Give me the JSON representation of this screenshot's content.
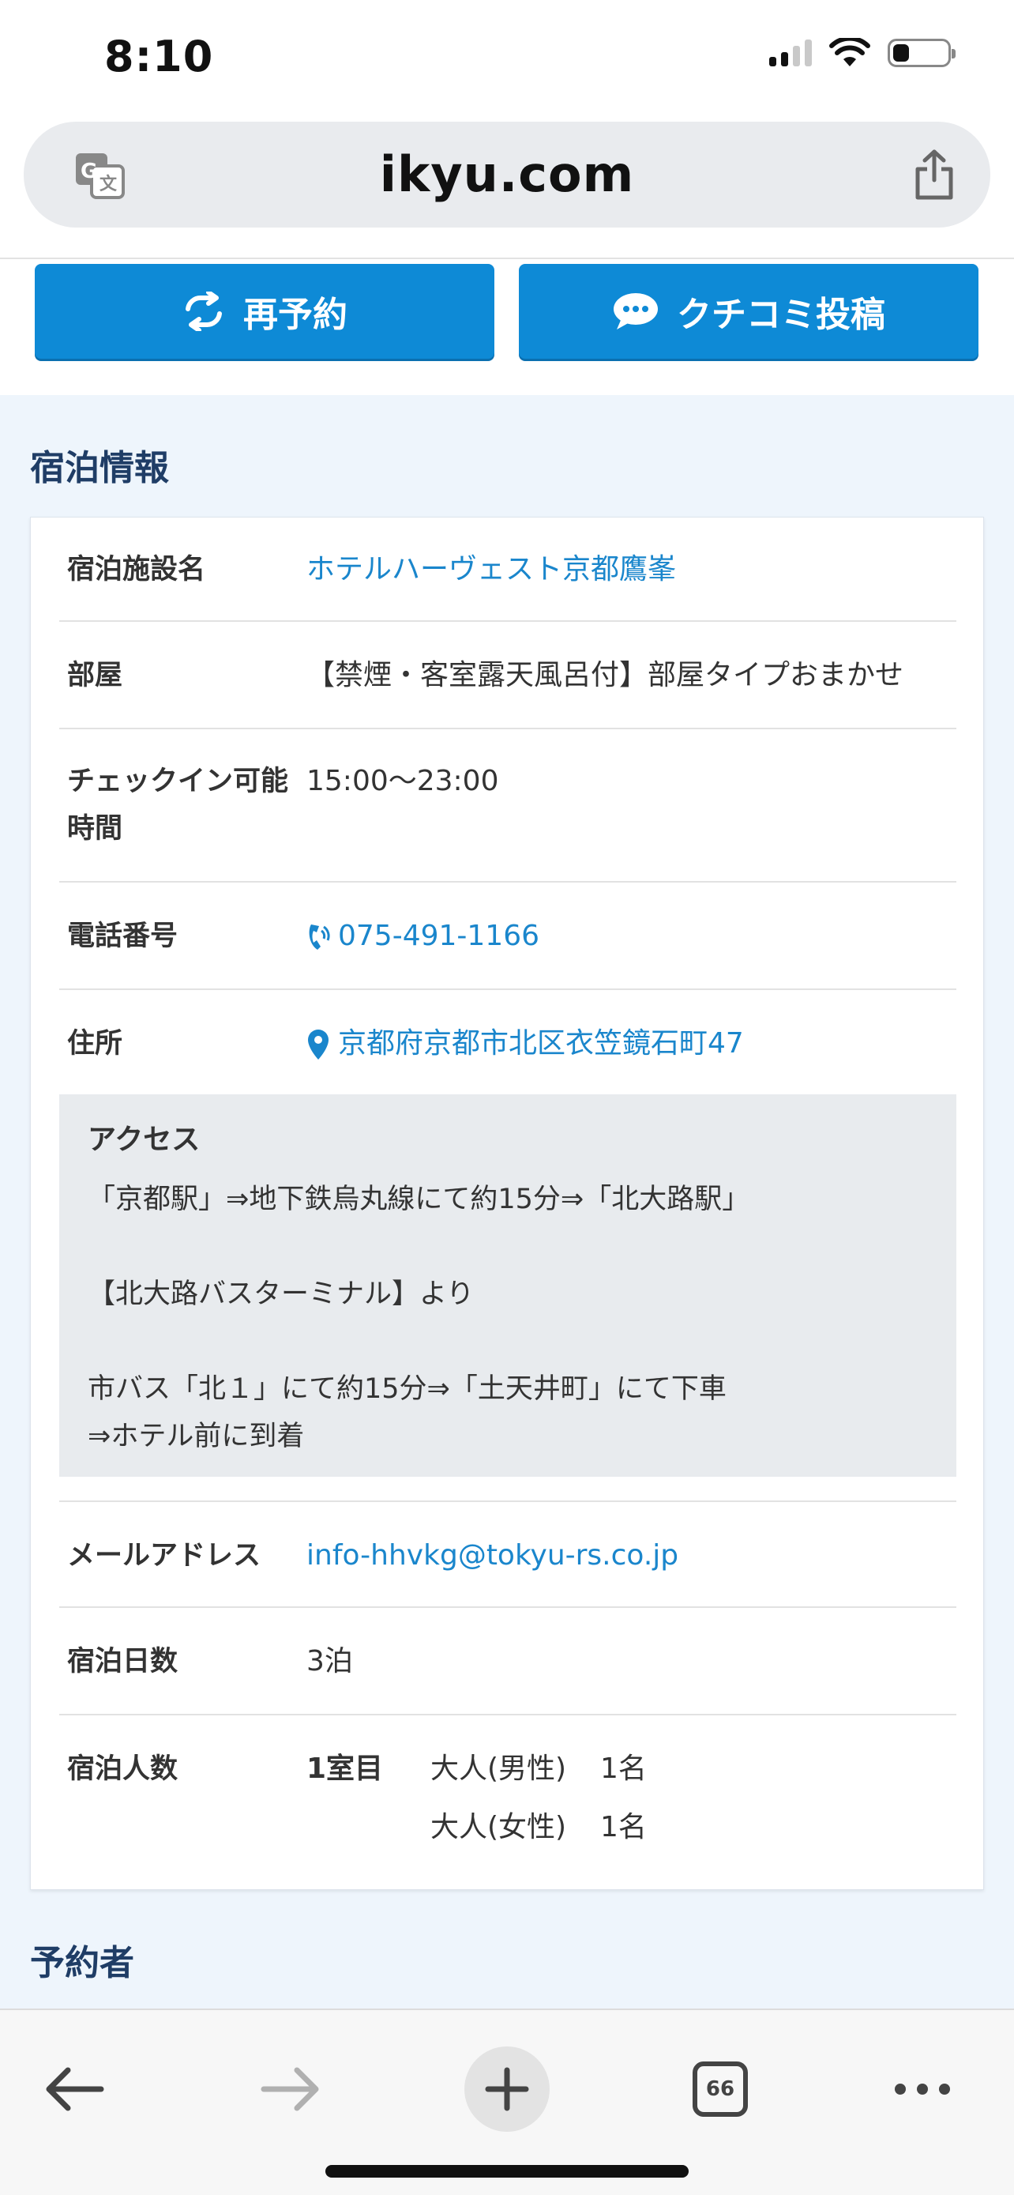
{
  "status_bar": {
    "time": "8:10"
  },
  "browser": {
    "url": "ikyu.com",
    "translate_icon": "translate-icon",
    "share_icon": "share-icon"
  },
  "actions": {
    "rebook_label": "再予約",
    "review_label": "クチコミ投稿",
    "rebook_icon": "repeat-icon",
    "review_icon": "chat-bubble-icon"
  },
  "stay_info": {
    "section_title": "宿泊情報",
    "facility": {
      "label": "宿泊施設名",
      "value": "ホテルハーヴェスト京都鷹峯"
    },
    "room": {
      "label": "部屋",
      "value": "【禁煙・客室露天風呂付】部屋タイプおまかせ"
    },
    "checkin": {
      "label_line1": "チェックイン可能",
      "label_line2": "時間",
      "value": "15:00〜23:00"
    },
    "phone": {
      "label": "電話番号",
      "value": "075-491-1166",
      "icon": "phone-icon"
    },
    "address": {
      "label": "住所",
      "value": "京都府京都市北区衣笠鏡石町47",
      "icon": "map-pin-icon"
    },
    "access": {
      "title": "アクセス",
      "line1": "「京都駅」⇒地下鉄烏丸線にて約15分⇒「北大路駅」",
      "line2": "【北大路バスターミナル】より",
      "line3": "市バス「北１」にて約15分⇒「土天井町」にて下車",
      "line4": "⇒ホテル前に到着"
    },
    "email": {
      "label": "メールアドレス",
      "value": "info-hhvkg@tokyu-rs.co.jp"
    },
    "nights": {
      "label": "宿泊日数",
      "value": "3泊"
    },
    "guests": {
      "label": "宿泊人数",
      "room_label": "1室目",
      "rows": [
        {
          "type": "大人(男性)",
          "count": "1名"
        },
        {
          "type": "大人(女性)",
          "count": "1名"
        }
      ]
    }
  },
  "booker": {
    "section_title": "予約者"
  },
  "toolbar": {
    "tab_count": "66",
    "back_icon": "back-arrow-icon",
    "forward_icon": "forward-arrow-icon",
    "new_tab_icon": "plus-icon",
    "more_icon": "more-icon"
  }
}
